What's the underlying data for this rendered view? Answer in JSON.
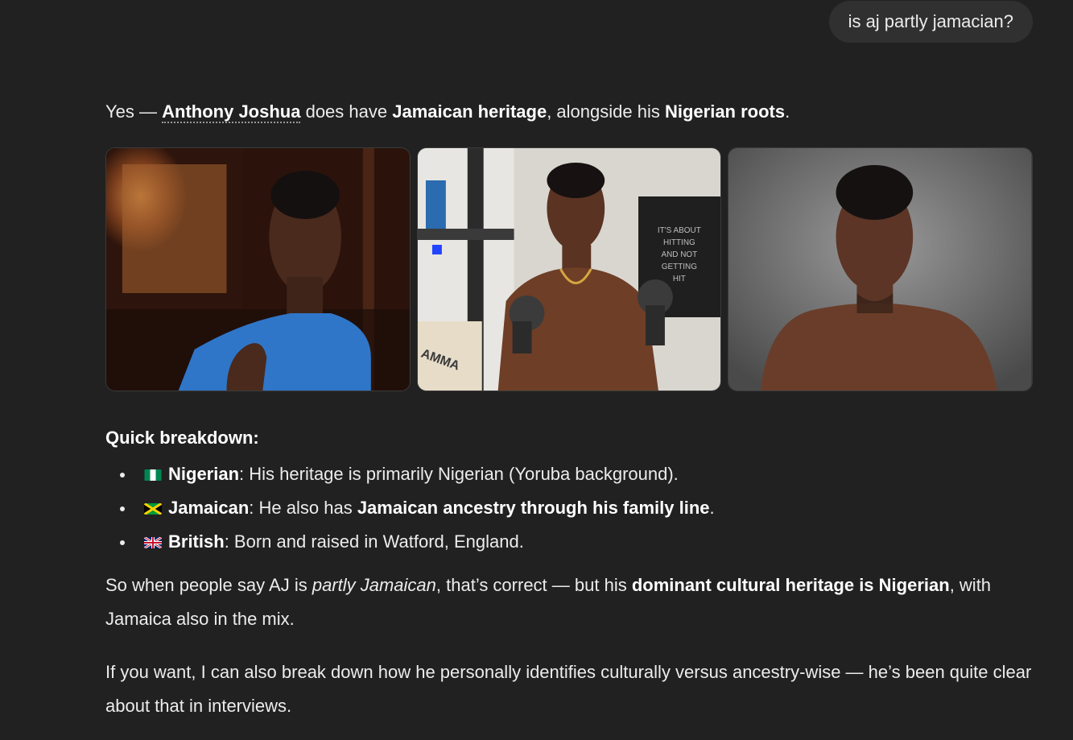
{
  "user_message": "is aj partly jamacian?",
  "answer": {
    "intro_prefix": "Yes — ",
    "intro_entity": "Anthony Joshua",
    "intro_mid1": " does have ",
    "intro_bold1": "Jamaican heritage",
    "intro_mid2": ", alongside his ",
    "intro_bold2": "Nigerian roots",
    "intro_suffix": ".",
    "heading": "Quick breakdown:",
    "items": [
      {
        "flag": "nigeria-flag",
        "label": "Nigerian",
        "text": ": His heritage is primarily Nigerian (Yoruba background)."
      },
      {
        "flag": "jamaica-flag",
        "label": "Jamaican",
        "text": ": He also has ",
        "bold": "Jamaican ancestry through his family line",
        "suffix": "."
      },
      {
        "flag": "uk-flag",
        "label": "British",
        "text": ": Born and raised in Watford, England."
      }
    ],
    "para1_a": "So when people say AJ is ",
    "para1_italic": "partly Jamaican",
    "para1_b": ", that’s correct — but his ",
    "para1_bold": "dominant cultural heritage is Nigerian",
    "para1_c": ", with Jamaica also in the mix.",
    "para2": "If you want, I can also break down how he personally identifies culturally versus ancestry-wise — he’s been quite clear about that in interviews."
  },
  "gallery": {
    "poster_text": "IT'S ABOUT HITTING AND NOT GETTING HIT",
    "shirt_text": "AMMA ALI"
  },
  "colors": {
    "background": "#212121",
    "bubble": "#303030",
    "text": "#ececec"
  }
}
